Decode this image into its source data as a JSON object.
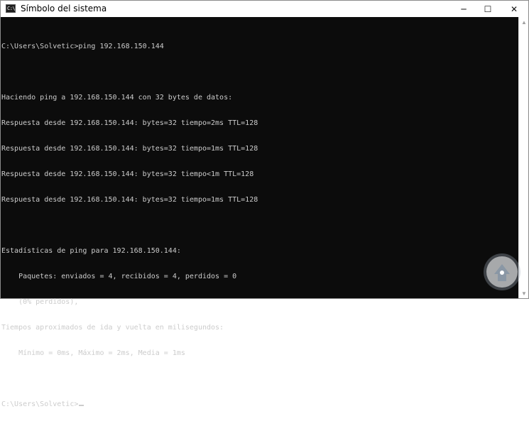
{
  "window": {
    "title": "Símbolo del sistema",
    "icon_label": "C:\\",
    "controls": {
      "minimize": "─",
      "maximize": "☐",
      "close": "✕"
    }
  },
  "console": {
    "lines": [
      "C:\\Users\\Solvetic>ping 192.168.150.144",
      "",
      "Haciendo ping a 192.168.150.144 con 32 bytes de datos:",
      "Respuesta desde 192.168.150.144: bytes=32 tiempo=2ms TTL=128",
      "Respuesta desde 192.168.150.144: bytes=32 tiempo=1ms TTL=128",
      "Respuesta desde 192.168.150.144: bytes=32 tiempo<1m TTL=128",
      "Respuesta desde 192.168.150.144: bytes=32 tiempo=1ms TTL=128",
      "",
      "Estadísticas de ping para 192.168.150.144:",
      "    Paquetes: enviados = 4, recibidos = 4, perdidos = 0",
      "    (0% perdidos),",
      "Tiempos aproximados de ida y vuelta en milisegundos:",
      "    Mínimo = 0ms, Máximo = 2ms, Media = 1ms",
      "",
      "C:\\Users\\Solvetic>"
    ]
  },
  "scrollbar": {
    "up_arrow": "▲",
    "down_arrow": "▼"
  },
  "colors": {
    "console_bg": "#0c0c0c",
    "console_text": "#cccccc",
    "titlebar_bg": "#ffffff",
    "watermark": "#9aa7b4"
  }
}
